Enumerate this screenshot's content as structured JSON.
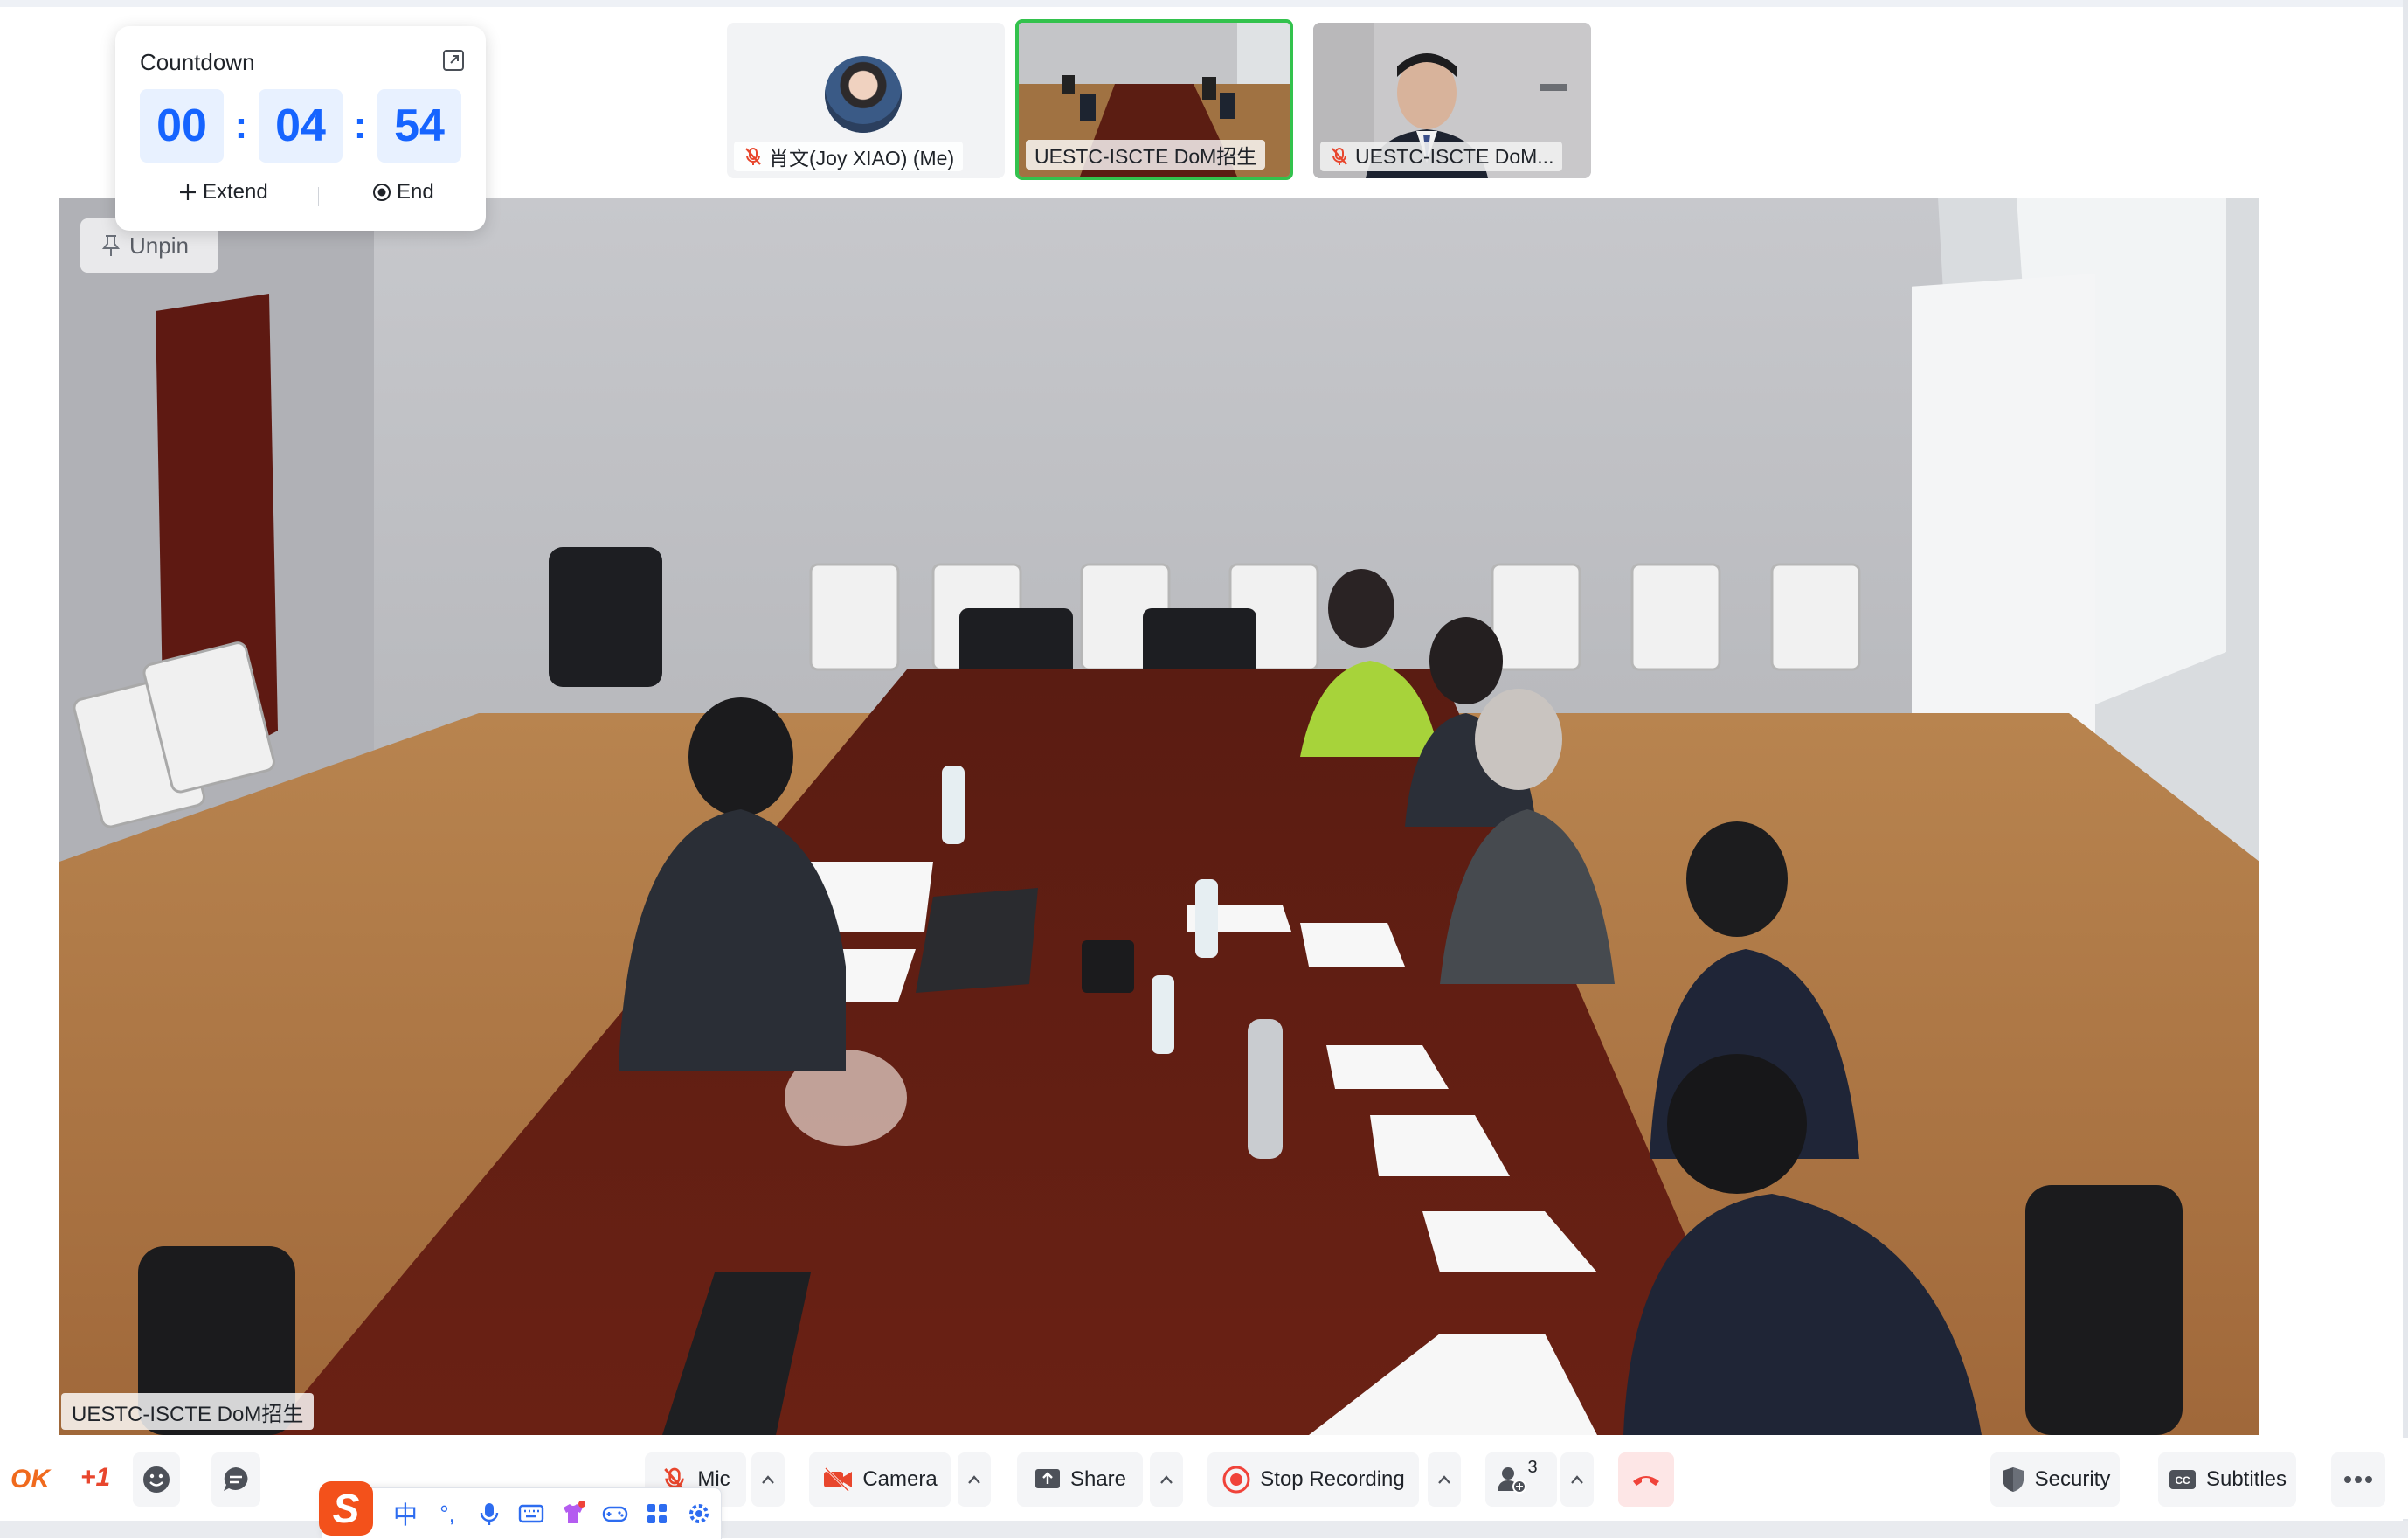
{
  "countdown": {
    "title": "Countdown",
    "hours": "00",
    "minutes": "04",
    "seconds": "54",
    "extend_label": "Extend",
    "end_label": "End"
  },
  "participants": [
    {
      "name": "肖文(Joy XIAO) (Me)",
      "muted": true
    },
    {
      "name": "UESTC-ISCTE DoM招生",
      "muted": false,
      "active_speaker": true
    },
    {
      "name": "UESTC-ISCTE DoM...",
      "muted": true
    }
  ],
  "main_video": {
    "unpin_label": "Unpin",
    "speaker_label": "UESTC-ISCTE DoM招生"
  },
  "toolbar": {
    "reactions": [
      "OK",
      "+1"
    ],
    "mic_label": "Mic",
    "camera_label": "Camera",
    "share_label": "Share",
    "record_label": "Stop Recording",
    "participants_count": "3",
    "security_label": "Security",
    "subtitles_label": "Subtitles"
  },
  "ime": {
    "logo": "S",
    "mode": "中",
    "punct": "°,"
  },
  "colors": {
    "accent": "#1664ff",
    "active_border": "#33c24d",
    "danger": "#e8462d",
    "record": "#f0433a"
  }
}
